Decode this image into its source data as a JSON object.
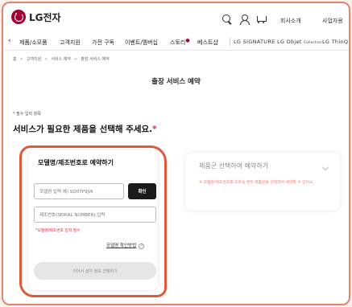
{
  "header": {
    "logo_text": "LG전자",
    "icons": [
      "search-icon",
      "user-icon",
      "cart-icon"
    ],
    "links": [
      "회사소개",
      "사업자용"
    ]
  },
  "nav": {
    "items": [
      "제품/소모품",
      "고객지원",
      "가전 구독",
      "이벤트/멤버십",
      "스토리",
      "베스트샵"
    ],
    "brands": [
      "LG SIGNATURE",
      "LG Objet",
      "LG ThinQ"
    ],
    "brand_sub": "Collection"
  },
  "breadcrumb": [
    "홈",
    "고객지원",
    "서비스 예약",
    "출장 서비스 예약"
  ],
  "page": {
    "title": "출장 서비스 예약",
    "required_note": "* 필수 입력 항목",
    "heading": "서비스가 필요한 제품을 선택해 주세요.",
    "heading_star": "*"
  },
  "left_card": {
    "title": "모델명/제조번호로 예약하기",
    "model_placeholder": "모델명 입력 예) SQ07P9JW",
    "confirm_label": "확인",
    "serial_placeholder": "제조번호(SERIAL NUMBER) 입력",
    "error_text": "*모델명/제조번호 입력 필수",
    "how_link": "모델명 확인방법",
    "next_button": "이어서 설치 정보 선택하기"
  },
  "right_card": {
    "title": "제품군 선택하여 예약하기",
    "note": "※ 모델명/제조번호를 모르실 경우 제품군을 선택하여 예약할 수 있어요."
  },
  "colors": {
    "brand": "#a50034",
    "highlight": "#e05a3a",
    "error": "#e0283c"
  }
}
